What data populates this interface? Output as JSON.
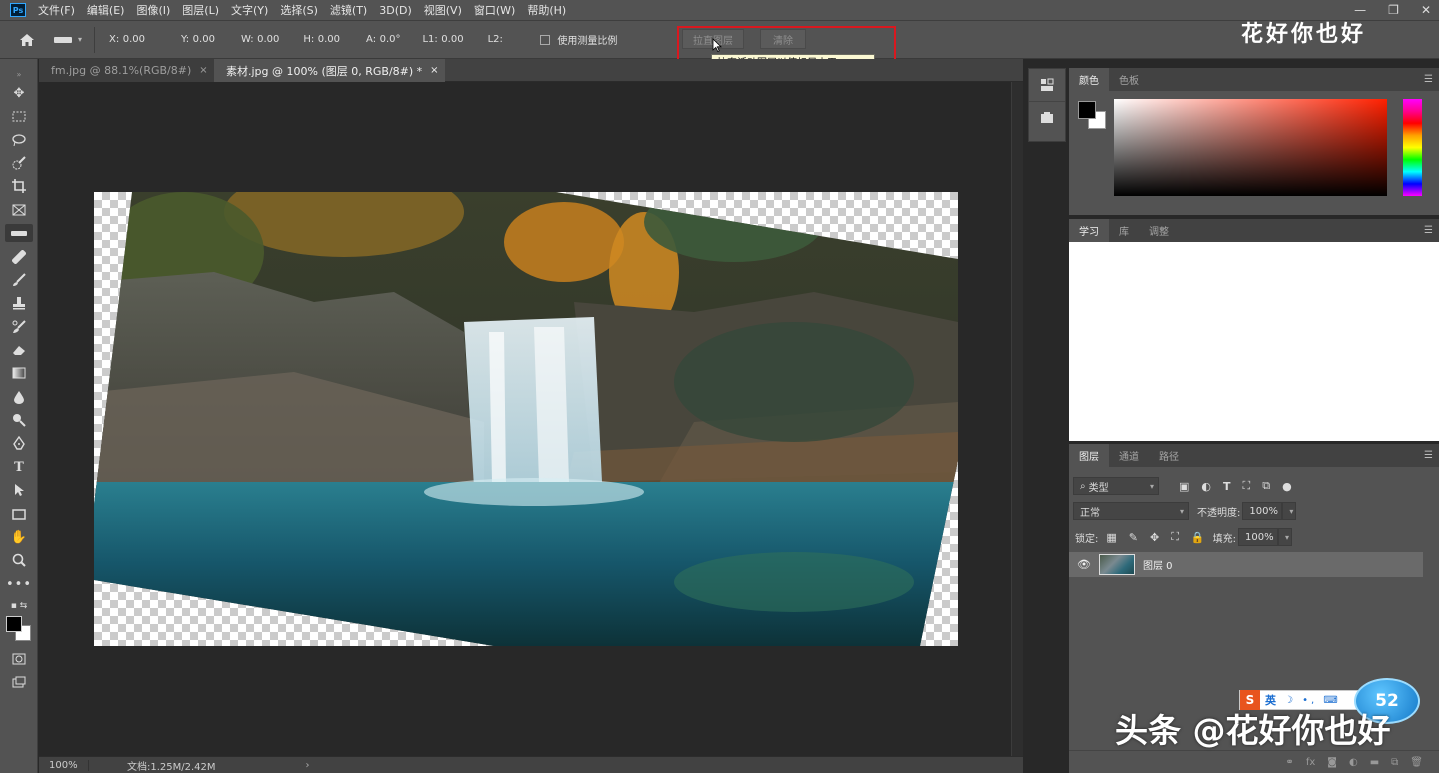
{
  "app": {
    "logo_text": "Ps",
    "menu": [
      "文件(F)",
      "编辑(E)",
      "图像(I)",
      "图层(L)",
      "文字(Y)",
      "选择(S)",
      "滤镜(T)",
      "3D(D)",
      "视图(V)",
      "窗口(W)",
      "帮助(H)"
    ],
    "window_controls": [
      "—",
      "❐",
      "✕"
    ]
  },
  "options_bar": {
    "coords": [
      {
        "label": "X:",
        "value": "0.00"
      },
      {
        "label": "Y:",
        "value": "0.00"
      },
      {
        "label": "W:",
        "value": "0.00"
      },
      {
        "label": "H:",
        "value": "0.00"
      },
      {
        "label": "A:",
        "value": "0.0°"
      },
      {
        "label": "L1:",
        "value": "0.00"
      },
      {
        "label": "L2:",
        "value": ""
      }
    ],
    "use_measurement_scale": "使用测量比例",
    "straighten_button": "拉直图层",
    "clear_button": "清除",
    "tooltip": "拉直活动图层以使标尺水平"
  },
  "watermark_top": "花好你也好",
  "document_tabs": [
    {
      "label": "fm.jpg @ 88.1%(RGB/8#)",
      "close": "×",
      "active": false
    },
    {
      "label": "素材.jpg @ 100% (图层 0, RGB/8#) *",
      "close": "×",
      "active": true
    }
  ],
  "status_bar": {
    "zoom": "100%",
    "doc_size": "文档:1.25M/2.42M",
    "arrow": "›"
  },
  "color_panel": {
    "tabs": [
      "颜色",
      "色板"
    ],
    "foreground": "#000000",
    "background": "#ffffff",
    "hue_color": "#ff2000"
  },
  "learn_panel": {
    "tabs": [
      "学习",
      "库",
      "调整"
    ]
  },
  "layers_panel": {
    "tabs": [
      "图层",
      "通道",
      "路径"
    ],
    "filter_kind": "类型",
    "blend_mode": "正常",
    "opacity_label": "不透明度:",
    "opacity_value": "100%",
    "lock_label": "锁定:",
    "fill_label": "填充:",
    "fill_value": "100%",
    "layers": [
      {
        "name": "图层 0",
        "visible": true
      }
    ]
  },
  "ime": {
    "logo": "S",
    "lang": "英",
    "icons": "☽ •, ⌨"
  },
  "speed_badge": "52",
  "watermark_bottom": "头条 @花好你也好"
}
